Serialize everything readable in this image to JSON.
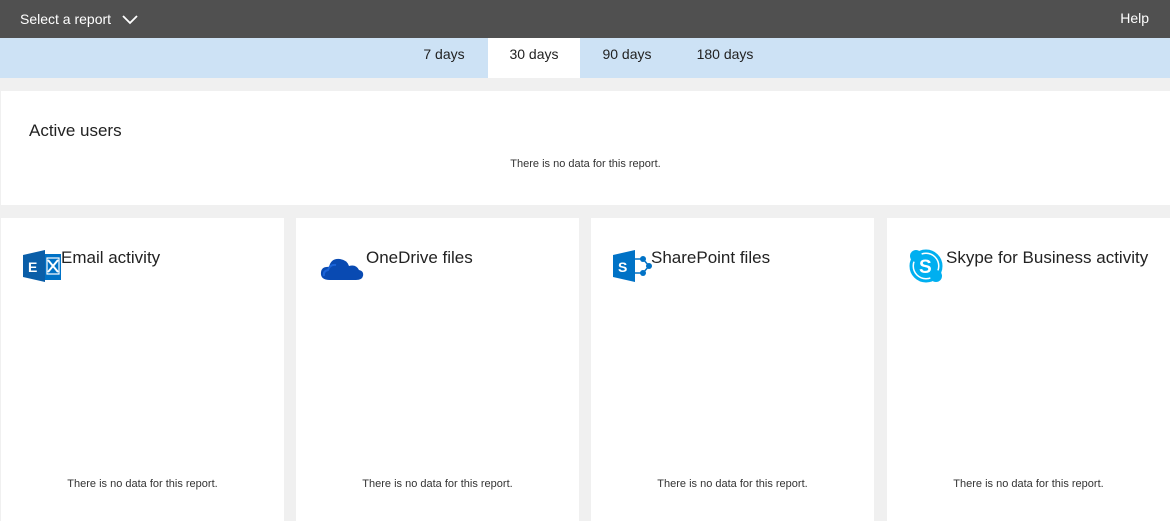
{
  "topbar": {
    "report_select_label": "Select a report",
    "help_label": "Help"
  },
  "tabs": [
    {
      "label": "7 days",
      "active": false
    },
    {
      "label": "30 days",
      "active": true
    },
    {
      "label": "90 days",
      "active": false
    },
    {
      "label": "180 days",
      "active": false
    }
  ],
  "active_users": {
    "title": "Active users",
    "no_data": "There is no data for this report."
  },
  "cards": [
    {
      "title": "Email activity",
      "icon": "exchange-icon",
      "no_data": "There is no data for this report."
    },
    {
      "title": "OneDrive files",
      "icon": "onedrive-icon",
      "no_data": "There is no data for this report."
    },
    {
      "title": "SharePoint files",
      "icon": "sharepoint-icon",
      "no_data": "There is no data for this report."
    },
    {
      "title": "Skype for Business activity",
      "icon": "skype-icon",
      "no_data": "There is no data for this report."
    }
  ],
  "colors": {
    "topbar": "#505050",
    "tabbar": "#cde2f5",
    "exchange": "#0072c6",
    "onedrive": "#094ab2",
    "sharepoint": "#0072c6",
    "skype": "#00aff0"
  }
}
